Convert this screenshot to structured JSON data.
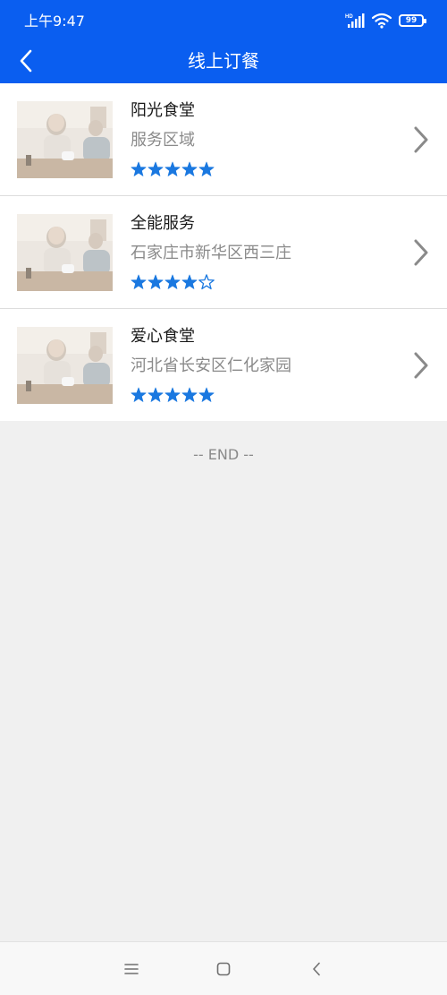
{
  "status_bar": {
    "time": "上午9:47",
    "network_label": "HD",
    "battery_level": "99"
  },
  "header": {
    "title": "线上订餐",
    "back_icon": "chevron-left-icon"
  },
  "colors": {
    "accent": "#0a5ef0",
    "star": "#1a78e0",
    "divider": "#dddddd",
    "page_bg": "#f0f0f0"
  },
  "canteens": [
    {
      "name": "阳光食堂",
      "address": "服务区域",
      "rating": 5,
      "max_rating": 5
    },
    {
      "name": "全能服务",
      "address": "石家庄市新华区西三庄",
      "rating": 4,
      "max_rating": 5
    },
    {
      "name": "爱心食堂",
      "address": "河北省长安区仁化家园",
      "rating": 5,
      "max_rating": 5
    }
  ],
  "list_end": "-- END --",
  "bottom_nav": {
    "items": [
      "menu-icon",
      "home-icon",
      "back-icon"
    ]
  }
}
